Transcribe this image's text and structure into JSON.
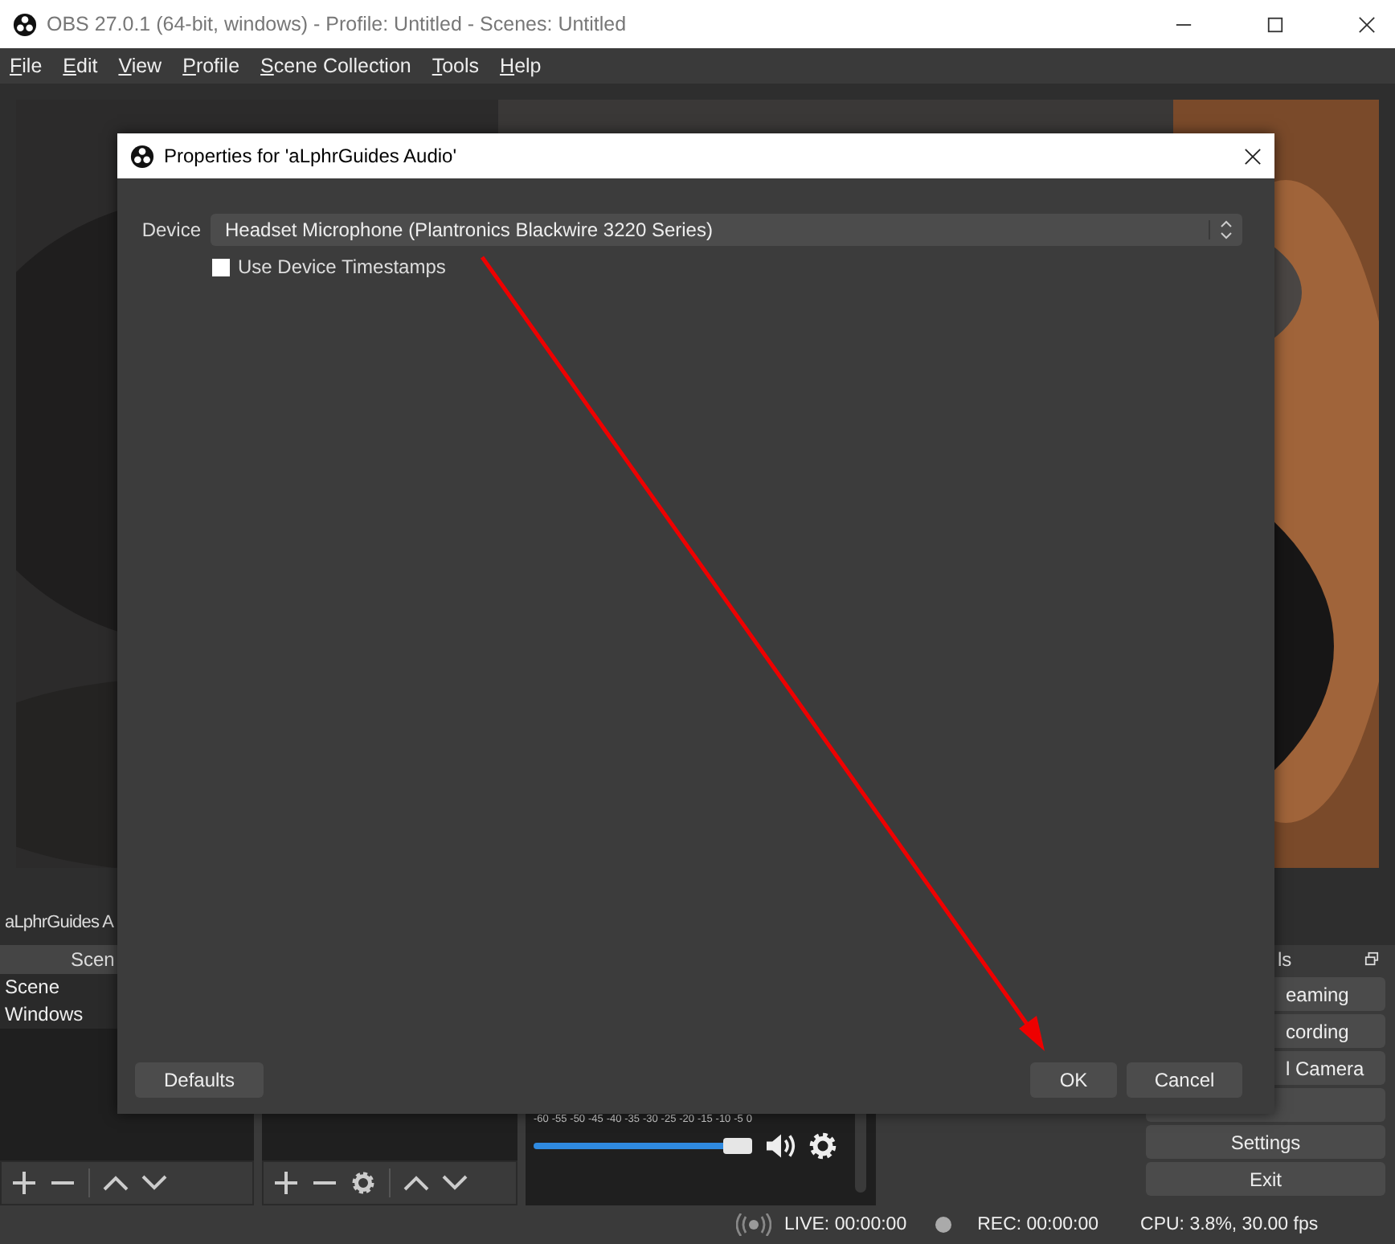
{
  "window": {
    "title": "OBS 27.0.1 (64-bit, windows) - Profile: Untitled - Scenes: Untitled"
  },
  "menu": [
    {
      "label": "File"
    },
    {
      "label": "Edit"
    },
    {
      "label": "View"
    },
    {
      "label": "Profile"
    },
    {
      "label": "Scene Collection"
    },
    {
      "label": "Tools"
    },
    {
      "label": "Help"
    }
  ],
  "source_label": "aLphrGuides A",
  "scenes": {
    "title": "Scen",
    "items": [
      {
        "label": "Scene"
      },
      {
        "label": "Windows"
      }
    ]
  },
  "mixer": {
    "ticks": [
      "-60",
      "-55",
      "-50",
      "-45",
      "-40",
      "-35",
      "-30",
      "-25",
      "-20",
      "-15",
      "-10",
      "-5",
      "0"
    ],
    "level": 0.94
  },
  "controls": {
    "title": "ls",
    "buttons": [
      {
        "kind": "partial",
        "label": "eaming"
      },
      {
        "kind": "partial",
        "label": "cording"
      },
      {
        "kind": "partial",
        "label": "l Camera"
      },
      {
        "kind": "hidden"
      },
      {
        "kind": "full",
        "label": "Settings"
      },
      {
        "kind": "full",
        "label": "Exit"
      }
    ]
  },
  "status_bar": {
    "live": "LIVE: 00:00:00",
    "rec": "REC: 00:00:00",
    "cpu": "CPU: 3.8%, 30.00 fps"
  },
  "dialog": {
    "title": "Properties for 'aLphrGuides Audio'",
    "device_label": "Device",
    "device_value": "Headset Microphone (Plantronics Blackwire 3220 Series)",
    "checkbox": {
      "label": "Use Device Timestamps",
      "checked": false
    },
    "defaults_button": "Defaults",
    "ok_button": "OK",
    "cancel_button": "Cancel"
  }
}
